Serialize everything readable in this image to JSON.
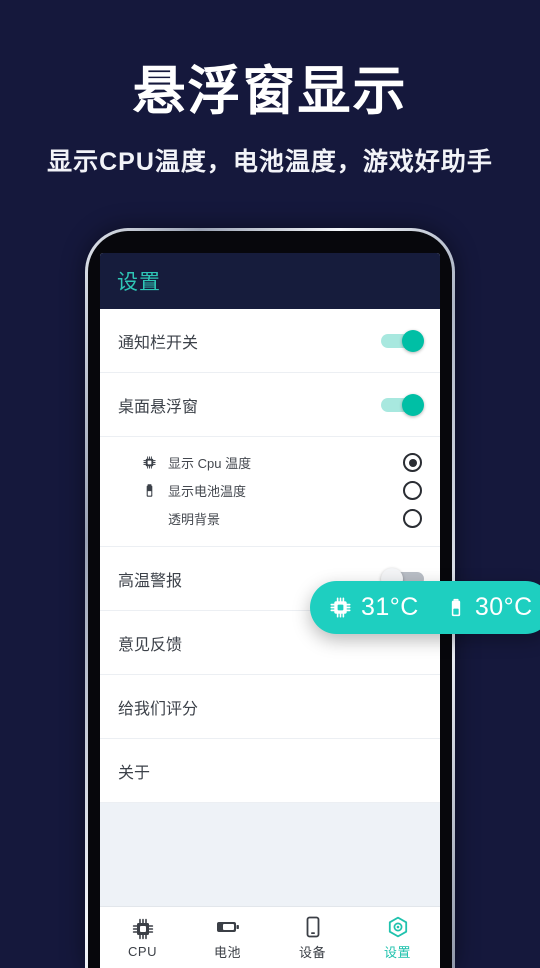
{
  "promo": {
    "title": "悬浮窗显示",
    "subtitle": "显示CPU温度，电池温度，游戏好助手"
  },
  "app": {
    "appbar_title": "设置",
    "settings_rows": [
      {
        "label": "通知栏开关",
        "control": "toggle",
        "state": "on"
      },
      {
        "label": "桌面悬浮窗",
        "control": "toggle",
        "state": "on"
      }
    ],
    "sub_options": [
      {
        "label": "显示 Cpu 温度",
        "icon": "cpu-icon",
        "selected": true
      },
      {
        "label": "显示电池温度",
        "icon": "battery-icon",
        "selected": false
      },
      {
        "label": "透明背景",
        "icon": "none",
        "selected": false
      }
    ],
    "alert_row": {
      "label": "高温警报",
      "control": "toggle",
      "state": "off"
    },
    "menu_rows": [
      {
        "label": "意见反馈"
      },
      {
        "label": "给我们评分"
      },
      {
        "label": "关于"
      }
    ],
    "bottom_nav": [
      {
        "label": "CPU",
        "icon": "cpu-icon",
        "active": false
      },
      {
        "label": "电池",
        "icon": "battery-icon",
        "active": false
      },
      {
        "label": "设备",
        "icon": "device-icon",
        "active": false
      },
      {
        "label": "设置",
        "icon": "gear-hexagon-icon",
        "active": true
      }
    ]
  },
  "float_widget": {
    "cpu_icon": "cpu-icon",
    "cpu_temp": "31°C",
    "battery_icon": "battery-icon",
    "battery_temp": "30°C"
  },
  "colors": {
    "page_background": "#15183c",
    "accent_teal": "#1ecfc0",
    "appbar": "#161c3c",
    "toggle_on": "#00bfa5",
    "screen_empty": "#eef2f7"
  }
}
